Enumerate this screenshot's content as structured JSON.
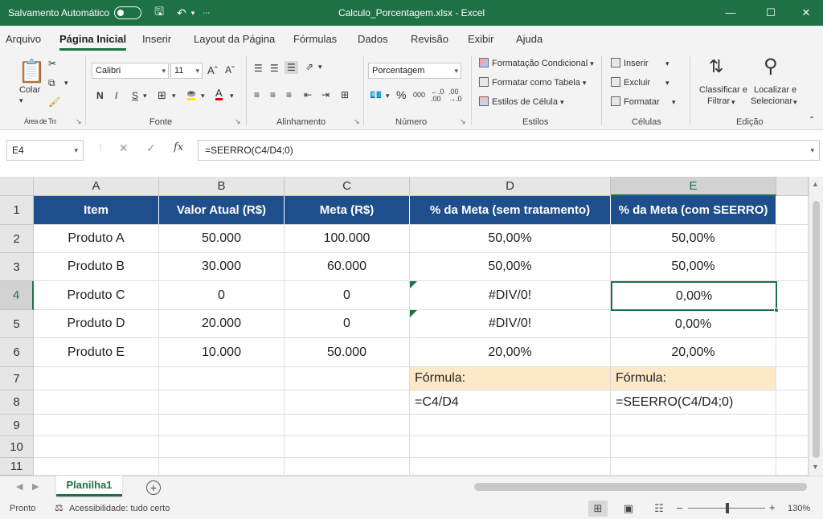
{
  "titlebar": {
    "autosave_label": "Salvamento Automático",
    "document_title": "Calculo_Porcentagem.xlsx  -  Excel"
  },
  "menu": {
    "tabs": [
      {
        "label": "Arquivo"
      },
      {
        "label": "Página Inicial",
        "active": true
      },
      {
        "label": "Inserir"
      },
      {
        "label": "Layout da Página"
      },
      {
        "label": "Fórmulas"
      },
      {
        "label": "Dados"
      },
      {
        "label": "Revisão"
      },
      {
        "label": "Exibir"
      },
      {
        "label": "Ajuda"
      }
    ]
  },
  "ribbon": {
    "clipboard": {
      "paste_label": "Colar",
      "group_label": "Área de Transferência"
    },
    "font": {
      "name": "Calibri",
      "size": "11",
      "grow": "Aˆ",
      "shrink": "Aˇ",
      "bold": "N",
      "italic": "I",
      "underline": "S",
      "group_label": "Fonte"
    },
    "alignment": {
      "group_label": "Alinhamento"
    },
    "number": {
      "format": "Porcentagem",
      "percent": "%",
      "thousands": "000",
      "group_label": "Número"
    },
    "styles": {
      "conditional": "Formatação Condicional",
      "as_table": "Formatar como Tabela",
      "cell_styles": "Estilos de Célula",
      "group_label": "Estilos"
    },
    "cells": {
      "insert": "Inserir",
      "delete": "Excluir",
      "format": "Formatar",
      "group_label": "Células"
    },
    "editing": {
      "sort_filter_1": "Classificar e",
      "sort_filter_2": "Filtrar",
      "find_select_1": "Localizar e",
      "find_select_2": "Selecionar",
      "group_label": "Edição"
    }
  },
  "formula_bar": {
    "name_box": "E4",
    "fx": "fx",
    "formula": "=SEERRO(C4/D4;0)"
  },
  "grid": {
    "columns": [
      "A",
      "B",
      "C",
      "D",
      "E"
    ],
    "selected_column": "E",
    "rows": [
      "1",
      "2",
      "3",
      "4",
      "5",
      "6",
      "7",
      "8",
      "9",
      "10",
      "11"
    ],
    "selected_row": "4",
    "header_row": [
      "Item",
      "Valor Atual (R$)",
      "Meta (R$)",
      "% da Meta (sem tratamento)",
      "% da Meta (com SEERRO)"
    ],
    "data_rows": [
      [
        "Produto A",
        "50.000",
        "100.000",
        "50,00%",
        "50,00%"
      ],
      [
        "Produto B",
        "30.000",
        "60.000",
        "50,00%",
        "50,00%"
      ],
      [
        "Produto C",
        "0",
        "0",
        "#DIV/0!",
        "0,00%"
      ],
      [
        "Produto D",
        "20.000",
        "0",
        "#DIV/0!",
        "0,00%"
      ],
      [
        "Produto E",
        "10.000",
        "50.000",
        "20,00%",
        "20,00%"
      ]
    ],
    "formula_label_d": "Fórmula:",
    "formula_label_e": "Fórmula:",
    "formula_text_d": "=C4/D4",
    "formula_text_e": "=SEERRO(C4/D4;0)",
    "colors": {
      "header_bg": "#1f4e8c",
      "note_bg": "#fde9c7",
      "accent": "#1e7145"
    }
  },
  "sheets": {
    "tabs": [
      {
        "label": "Planilha1",
        "active": true
      }
    ],
    "add": "+"
  },
  "statusbar": {
    "ready": "Pronto",
    "accessibility": "Acessibilidade: tudo certo",
    "zoom": "130%",
    "zoom_minus": "–",
    "zoom_plus": "+"
  }
}
